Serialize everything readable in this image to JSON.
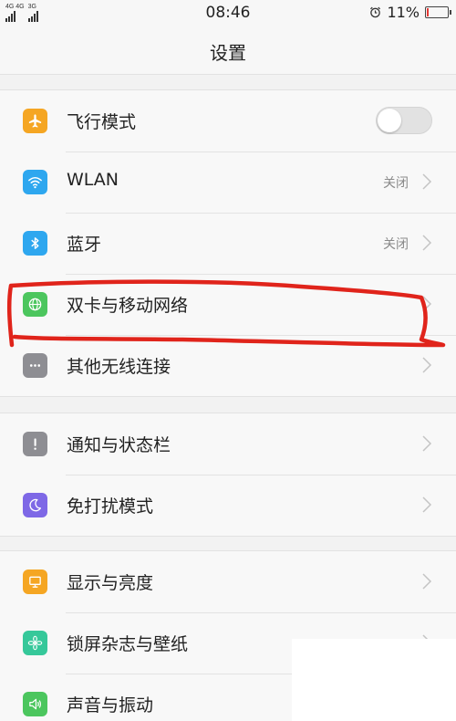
{
  "status_bar": {
    "sim1_label": "4G 4G",
    "sim2_label": "3G",
    "time": "08:46",
    "battery_text": "11%",
    "battery_level": 0.11,
    "battery_color": "#e53935"
  },
  "header": {
    "title": "设置"
  },
  "groups": [
    {
      "items": [
        {
          "label": "飞行模式",
          "icon": "airplane-icon",
          "icon_color": "#f5a623",
          "toggle": false
        },
        {
          "label": "WLAN",
          "icon": "wifi-icon",
          "icon_color": "#2ea7ef",
          "value": "关闭"
        },
        {
          "label": "蓝牙",
          "icon": "bluetooth-icon",
          "icon_color": "#2ea7ef",
          "value": "关闭"
        },
        {
          "label": "双卡与移动网络",
          "icon": "globe-icon",
          "icon_color": "#4cc65e"
        },
        {
          "label": "其他无线连接",
          "icon": "more-icon",
          "icon_color": "#8e8e93"
        }
      ]
    },
    {
      "items": [
        {
          "label": "通知与状态栏",
          "icon": "notification-icon",
          "icon_color": "#8e8e93"
        },
        {
          "label": "免打扰模式",
          "icon": "moon-icon",
          "icon_color": "#7e68e6"
        }
      ]
    },
    {
      "items": [
        {
          "label": "显示与亮度",
          "icon": "display-icon",
          "icon_color": "#f5a623"
        },
        {
          "label": "锁屏杂志与壁纸",
          "icon": "flower-icon",
          "icon_color": "#36c89a"
        },
        {
          "label": "声音与振动",
          "icon": "speaker-icon",
          "icon_color": "#4cc65e"
        }
      ]
    }
  ],
  "annotation_color": "#e0241b"
}
